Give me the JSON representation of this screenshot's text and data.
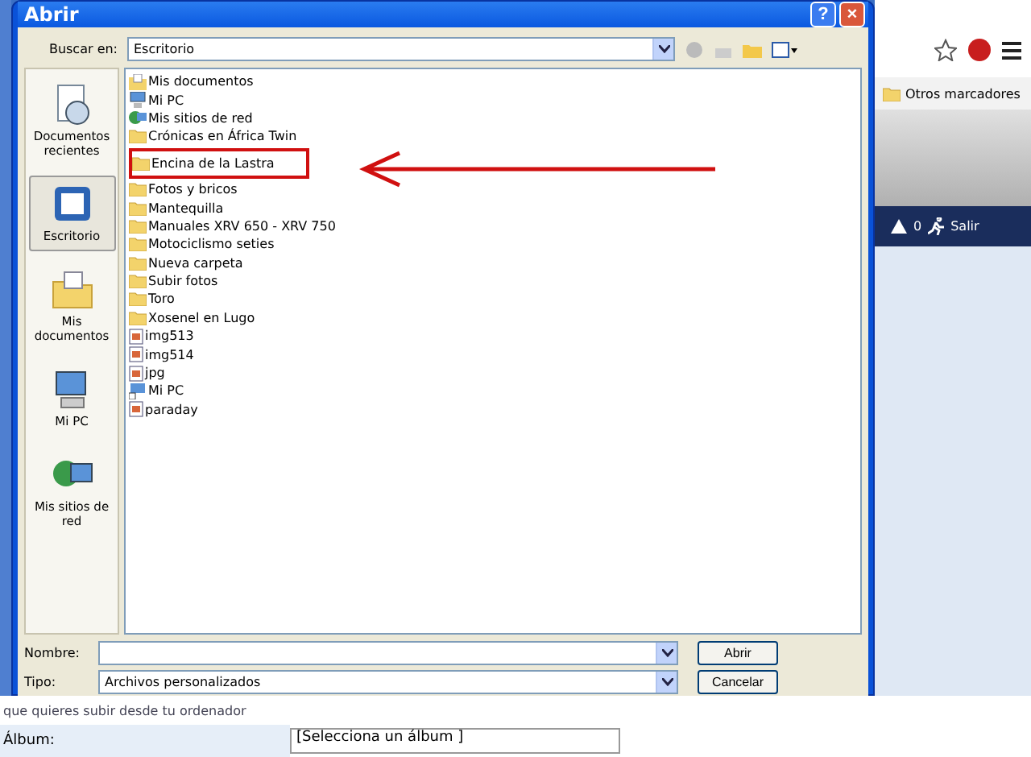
{
  "dialog": {
    "title": "Abrir",
    "help_button": "?",
    "close_button": "×",
    "look_in": {
      "label": "Buscar en:",
      "value": "Escritorio"
    },
    "places": [
      {
        "label": "Documentos recientes",
        "kind": "recent",
        "selected": false
      },
      {
        "label": "Escritorio",
        "kind": "desktop",
        "selected": true
      },
      {
        "label": "Mis documentos",
        "kind": "documents",
        "selected": false
      },
      {
        "label": "Mi PC",
        "kind": "computer",
        "selected": false
      },
      {
        "label": "Mis sitios de red",
        "kind": "network",
        "selected": false
      }
    ],
    "files": [
      {
        "name": "Mis documentos",
        "kind": "documents"
      },
      {
        "name": "Mi PC",
        "kind": "computer"
      },
      {
        "name": "Mis sitios de red",
        "kind": "network"
      },
      {
        "name": "Crónicas en África Twin",
        "kind": "folder"
      },
      {
        "name": "Encina de la Lastra",
        "kind": "folder",
        "highlighted": true
      },
      {
        "name": "Fotos y bricos",
        "kind": "folder"
      },
      {
        "name": "Mantequilla",
        "kind": "folder"
      },
      {
        "name": "Manuales XRV 650 - XRV 750",
        "kind": "folder"
      },
      {
        "name": "Motociclismo seties",
        "kind": "folder"
      },
      {
        "name": "Nueva carpeta",
        "kind": "folder"
      },
      {
        "name": "Subir fotos",
        "kind": "folder"
      },
      {
        "name": "Toro",
        "kind": "folder"
      },
      {
        "name": "Xosenel en Lugo",
        "kind": "folder"
      },
      {
        "name": "img513",
        "kind": "image"
      },
      {
        "name": "img514",
        "kind": "image"
      },
      {
        "name": "jpg",
        "kind": "image"
      },
      {
        "name": "Mi PC",
        "kind": "shortcut"
      },
      {
        "name": "paraday",
        "kind": "image"
      }
    ],
    "filename": {
      "label": "Nombre:"
    },
    "filetype": {
      "label": "Tipo:",
      "value": "Archivos personalizados"
    },
    "buttons": [
      "Abrir",
      "Cancelar"
    ]
  },
  "browser": {
    "bookmark": "Otros marcadores",
    "alerts": "0",
    "logout": "Salir",
    "hint": "que quieres subir desde tu ordenador",
    "album_label": "Álbum:",
    "album_select": "[Selecciona un álbum ]"
  }
}
